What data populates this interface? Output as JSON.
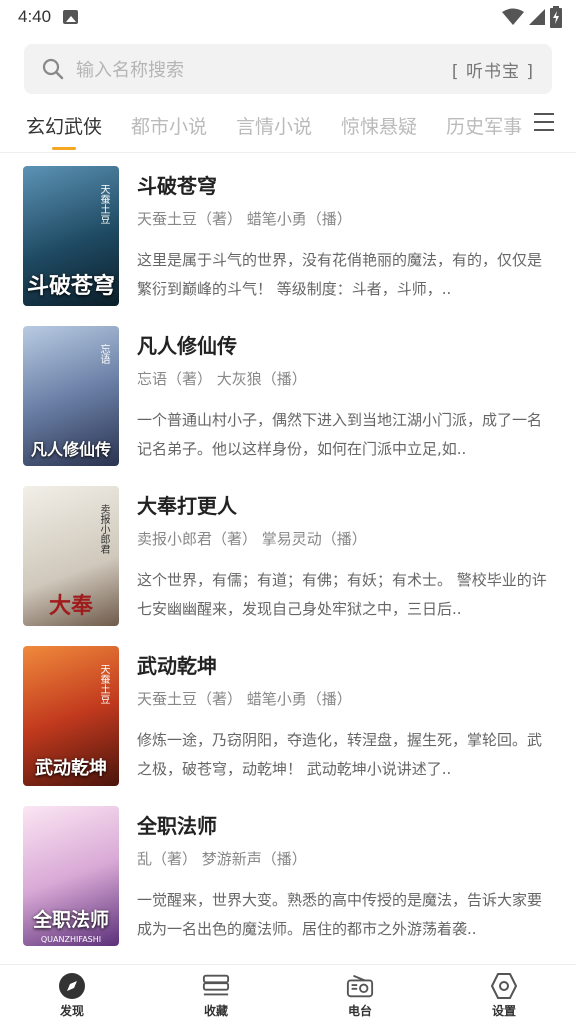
{
  "status_bar": {
    "time": "4:40"
  },
  "search": {
    "placeholder": "输入名称搜索",
    "brand": "[ 听书宝 ]"
  },
  "tabs": [
    {
      "label": "玄幻武侠",
      "active": true
    },
    {
      "label": "都市小说",
      "active": false
    },
    {
      "label": "言情小说",
      "active": false
    },
    {
      "label": "惊悚悬疑",
      "active": false
    },
    {
      "label": "历史军事",
      "active": false
    }
  ],
  "books": [
    {
      "title": "斗破苍穹",
      "meta": "天蚕土豆（著） 蜡笔小勇（播）",
      "desc": "这里是属于斗气的世界，没有花俏艳丽的魔法，有的，仅仅是繁衍到巅峰的斗气！ 等级制度：斗者，斗师，..",
      "cover_title": "斗破苍穹",
      "cover_author": "天蚕土豆",
      "cover_colors": [
        "#3a6e8f",
        "#0e2a3a"
      ]
    },
    {
      "title": "凡人修仙传",
      "meta": "忘语（著） 大灰狼（播）",
      "desc": "一个普通山村小子，偶然下进入到当地江湖小门派，成了一名记名弟子。他以这样身份，如何在门派中立足,如..",
      "cover_title": "凡人修仙传",
      "cover_author": "忘语",
      "cover_colors": [
        "#8fa7c8",
        "#2e3b5a"
      ]
    },
    {
      "title": "大奉打更人",
      "meta": "卖报小郎君（著） 掌易灵动（播）",
      "desc": "这个世界，有儒；有道；有佛；有妖；有术士。 警校毕业的许七安幽幽醒来，发现自己身处牢狱之中，三日后..",
      "cover_title": "大奉",
      "cover_author": "卖报小郎君",
      "cover_colors": [
        "#e8e4dc",
        "#8a1b1b"
      ]
    },
    {
      "title": "武动乾坤",
      "meta": "天蚕土豆（著） 蜡笔小勇（播）",
      "desc": "修炼一途，乃窃阴阳，夺造化，转涅盘，握生死，掌轮回。武之极，破苍穹，动乾坤！ 武动乾坤小说讲述了..",
      "cover_title": "武动乾坤",
      "cover_author": "天蚕土豆",
      "cover_colors": [
        "#e05a2a",
        "#5a1a10"
      ]
    },
    {
      "title": "全职法师",
      "meta": "乱（著） 梦游新声（播）",
      "desc": "一觉醒来，世界大变。熟悉的高中传授的是魔法，告诉大家要成为一名出色的魔法师。居住的都市之外游荡着袭..",
      "cover_title": "全职法师",
      "cover_author": "QUANZHIFASHI",
      "cover_colors": [
        "#f3d9ec",
        "#6b3a8c"
      ]
    }
  ],
  "bottom_nav": [
    {
      "label": "发现",
      "icon": "compass-icon"
    },
    {
      "label": "收藏",
      "icon": "stack-icon"
    },
    {
      "label": "电台",
      "icon": "radio-icon"
    },
    {
      "label": "设置",
      "icon": "hexagon-gear-icon"
    }
  ]
}
